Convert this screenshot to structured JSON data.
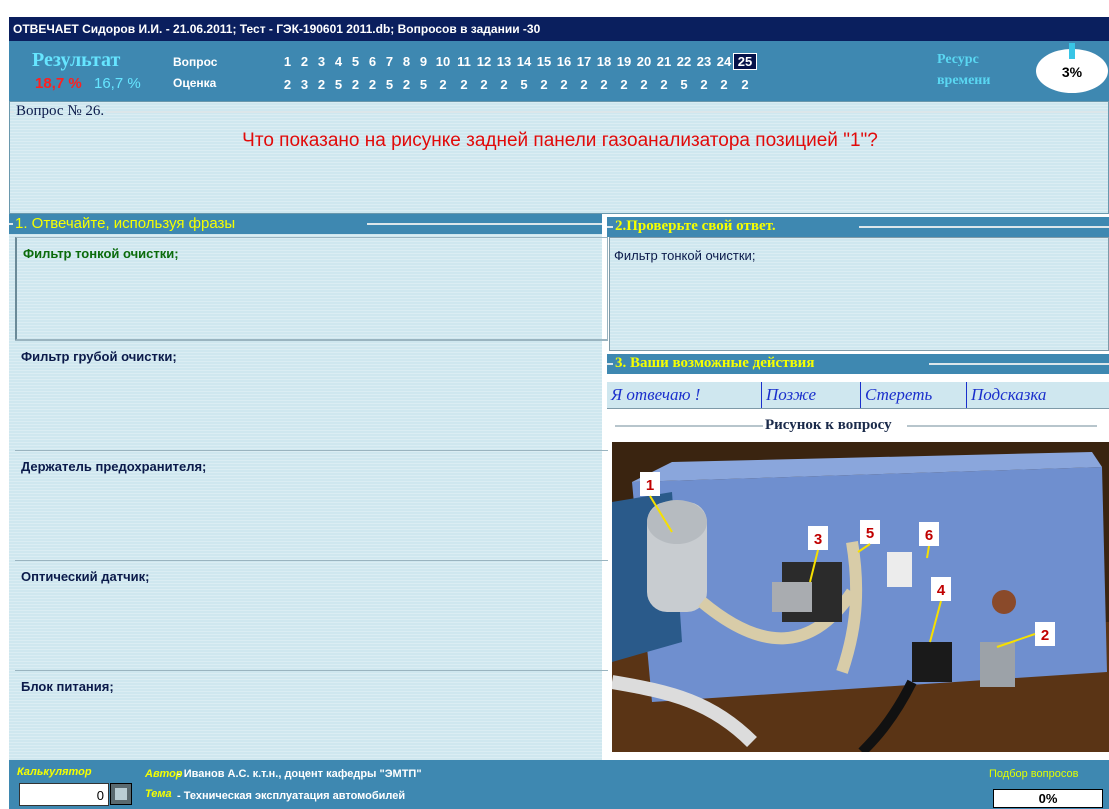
{
  "window": {
    "title": "ОТВЕЧАЕТ Сидоров И.И. - 21.06.2011; Тест - ГЭК-190601 2011.db; Вопросов в задании -30"
  },
  "header": {
    "result_label": "Результат",
    "percent_red": "18,7 %",
    "percent_cyan": "16,7 %",
    "question_label": "Вопрос",
    "grade_label": "Оценка",
    "questions": [
      "1",
      "2",
      "3",
      "4",
      "5",
      "6",
      "7",
      "8",
      "9",
      "10",
      "11",
      "12",
      "13",
      "14",
      "15",
      "16",
      "17",
      "18",
      "19",
      "20",
      "21",
      "22",
      "23",
      "24",
      "25"
    ],
    "grades": [
      "2",
      "3",
      "2",
      "5",
      "2",
      "2",
      "5",
      "2",
      "5",
      "2",
      "2",
      "2",
      "2",
      "5",
      "2",
      "2",
      "2",
      "2",
      "2",
      "2",
      "2",
      "5",
      "2",
      "2",
      "2"
    ],
    "current_question": "25",
    "time_label_1": "Ресурс",
    "time_label_2": "времени",
    "time_value": "3%"
  },
  "question": {
    "number_label": "Вопрос № 26.",
    "text": "Что показано на рисунке задней панели газоанализатора  позицией \"1\"?"
  },
  "phrases": {
    "title": "1. Отвечайте, используя фразы",
    "items": [
      "Фильтр тонкой очистки;",
      "Фильтр грубой очистки;",
      "Держатель предохранителя;",
      "Оптический датчик;",
      "Блок питания;"
    ]
  },
  "check": {
    "title": "2.Проверьте свой ответ.",
    "answer": "Фильтр тонкой очистки;"
  },
  "actions": {
    "title": "3. Ваши возможные действия",
    "answer": "Я отвечаю !",
    "later": "Позже",
    "erase": "Стереть",
    "hint": "Подсказка"
  },
  "picture": {
    "title": "Рисунок к вопросу",
    "labels": [
      "1",
      "2",
      "3",
      "4",
      "5",
      "6"
    ]
  },
  "footer": {
    "calc_label": "Калькулятор",
    "calc_value": "0",
    "author_key": "Автор",
    "author_value": "- Иванов А.С. к.т.н., доцент кафедры \"ЭМТП\"",
    "topic_key": "Тема",
    "topic_value": "- Техническая эксплуатация автомобилей",
    "pick_label": "Подбор вопросов",
    "pick_value": "0%"
  },
  "colors": {
    "header_bg": "#3e88b1",
    "title_bar": "#0a1f5e",
    "panel_bg": "#cfe7ef",
    "question_text": "#e10a0a",
    "accent_cyan": "#66e5ff",
    "accent_yellow": "#f6ff00"
  }
}
